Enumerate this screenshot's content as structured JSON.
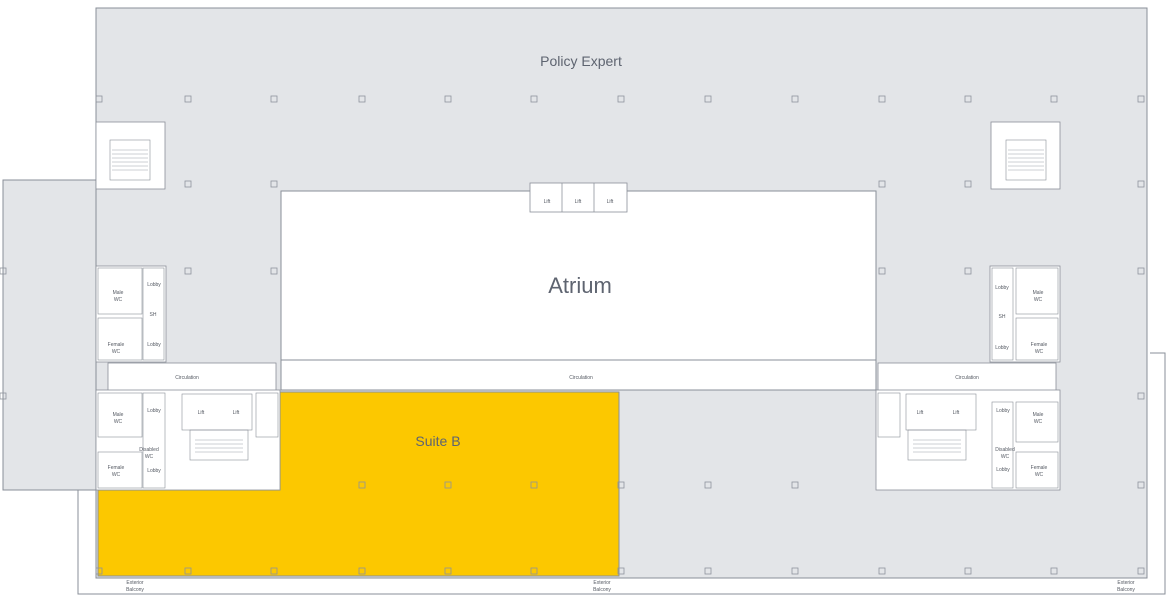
{
  "colors": {
    "floor": "#e3e5e8",
    "suite_highlight": "#fcc800",
    "wall": "#8a8f98",
    "text": "#5e6470"
  },
  "labels": {
    "policy_expert": "Policy Expert",
    "atrium": "Atrium",
    "suite_b": "Suite B",
    "lift": "Lift",
    "circulation": "Circulation",
    "lobby": "Lobby",
    "sh": "SH",
    "male_wc_1": "Male",
    "male_wc_2": "WC",
    "female_wc_1": "Female",
    "female_wc_2": "WC",
    "disabled_wc_1": "Disabled",
    "disabled_wc_2": "WC",
    "exterior_1": "Exterior",
    "exterior_2": "Balcony"
  }
}
